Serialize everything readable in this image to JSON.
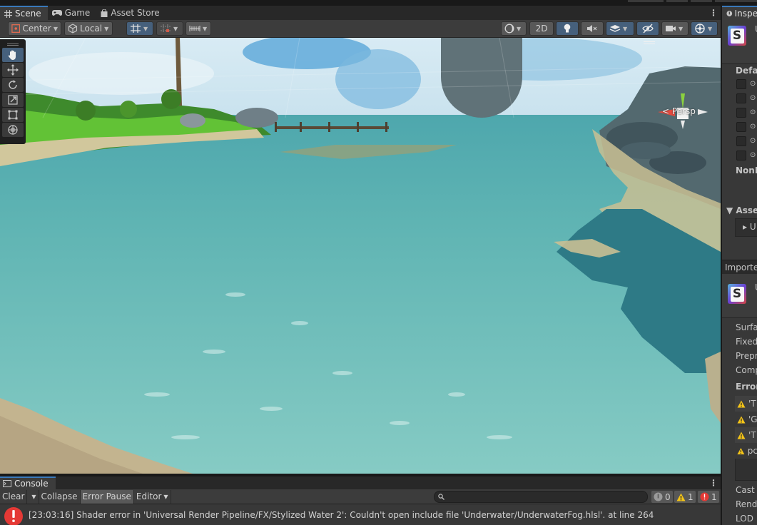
{
  "scene_tabs": [
    {
      "label": "Scene",
      "icon": "scene-grid-icon",
      "active": true
    },
    {
      "label": "Game",
      "icon": "gamepad-icon",
      "active": false
    },
    {
      "label": "Asset Store",
      "icon": "shopping-bag-icon",
      "active": false
    }
  ],
  "scene_toolbar": {
    "pivot_label": "Center",
    "space_label": "Local",
    "mode_2d_label": "2D"
  },
  "viewport": {
    "view_mode_label": "< Persp"
  },
  "console": {
    "tab_label": "Console",
    "clear_label": "Clear",
    "collapse_label": "Collapse",
    "error_pause_label": "Error Pause",
    "editor_label": "Editor",
    "search_value": "",
    "log_count": "0",
    "warning_count": "1",
    "error_count": "1",
    "message": "[23:03:16] Shader error in 'Universal Render Pipeline/FX/Stylized Water 2': Couldn't open include file 'Underwater/UnderwaterFog.hlsl'. at line 264"
  },
  "inspector": {
    "tab_label": "Inspe",
    "header_name": "U",
    "section_defaults": "Defau",
    "section_nonm": "NonM",
    "section_assets": "Asse",
    "assets_item": "U",
    "imported_label": "Imported",
    "imported_name": "U",
    "fields": [
      "Surfa",
      "Fixed",
      "Prepr",
      "Comp"
    ],
    "errors_label": "Errors",
    "errors": [
      "'T",
      "'G",
      "'T",
      "pc"
    ],
    "bottom_fields": [
      "Cast s",
      "Rende",
      "LOD"
    ]
  },
  "colors": {
    "accent_blue": "#3a79bb",
    "warning_yellow": "#f5c518",
    "error_red": "#e53935"
  }
}
